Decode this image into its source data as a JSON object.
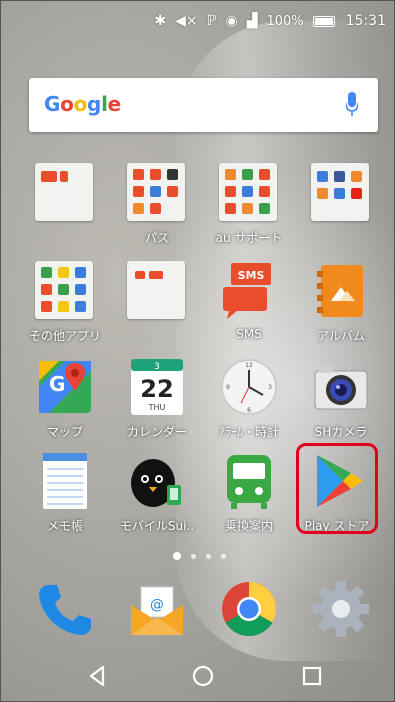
{
  "status_bar": {
    "battery_percent": "100%",
    "time": "15:31",
    "icons": [
      "bluetooth-icon",
      "mute-icon",
      "nfc-icon",
      "wifi-icon",
      "signal-icon",
      "battery-icon"
    ]
  },
  "search": {
    "logo_letters": [
      "G",
      "o",
      "o",
      "g",
      "l",
      "e"
    ],
    "colors": [
      "#4285f4",
      "#ea4335",
      "#fbbc05",
      "#4285f4",
      "#34a853",
      "#ea4335"
    ]
  },
  "apps": {
    "row1": [
      "",
      "パス",
      "au サポート",
      ""
    ],
    "row2": [
      "その他アプリ",
      "",
      "SMS",
      "アルバム"
    ],
    "row3": [
      "マップ",
      "カレンダー",
      "ｱﾗｰﾑ・時計",
      "SHカメラ"
    ],
    "row4": [
      "メモ帳",
      "モバイルSui..",
      "乗換案内",
      "Play ストア"
    ]
  },
  "sms_icon_text": "SMS",
  "calendar": {
    "month_num": "3",
    "day": "22",
    "weekday": "THU"
  },
  "dock": [
    "phone-icon",
    "email-icon",
    "chrome-icon",
    "settings-icon"
  ],
  "navbar": [
    "back-button",
    "home-button",
    "recents-button"
  ],
  "highlight_color": "#e0001b"
}
